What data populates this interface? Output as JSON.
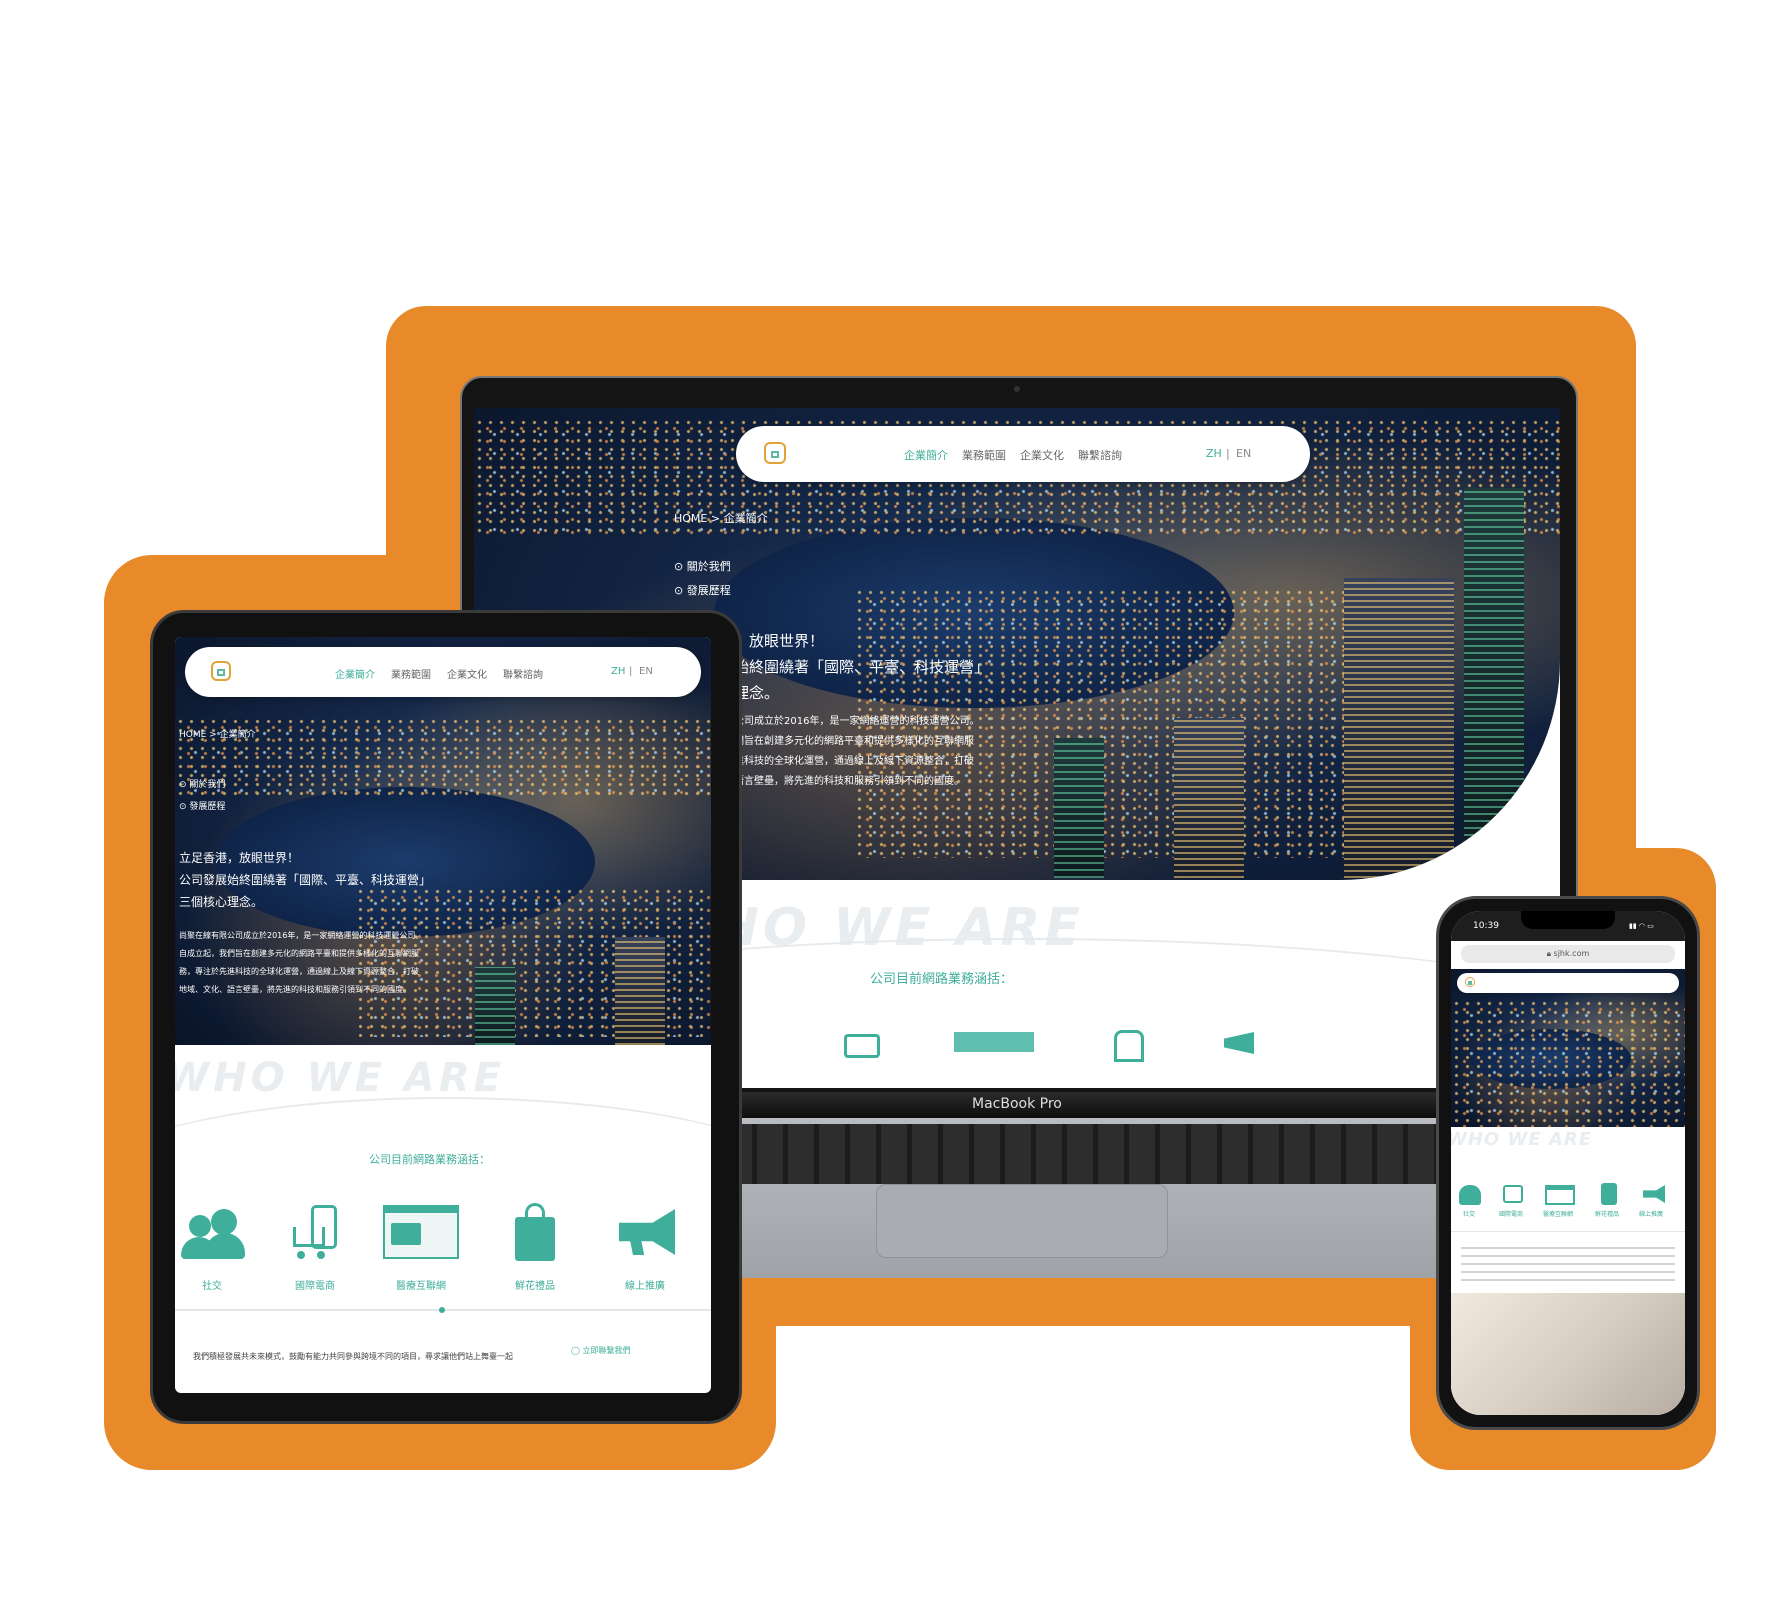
{
  "brand_colors": {
    "orange": "#e8892a",
    "teal": "#3fae9a",
    "dark": "#1a1a1a"
  },
  "laptop": {
    "model_label": "MacBook Pro",
    "nav": [
      "企業簡介",
      "業務範圍",
      "企業文化",
      "聯繫諮詢"
    ],
    "lang": {
      "zh": "ZH",
      "sep": "|",
      "en": "EN"
    },
    "breadcrumb": "HOME > 企業簡介",
    "side_links": [
      "關於我們",
      "發展歷程"
    ],
    "headline": [
      "立足香港，放眼世界！",
      "公司發展始終圍繞著「國際、平臺、科技運營」",
      "三個核心理念。"
    ],
    "body": [
      "尚聚在線有限公司成立於2016年，是一家網絡運營的科技運營公司。",
      "自成立起，我們旨在創建多元化的網路平臺和提供多樣化的互聯網服",
      "務，專注於先進科技的全球化運營，通過線上及線下資源整合，打破",
      "地域、文化、語言壁壘，將先進的科技和服務引領到不同的國度。"
    ],
    "ghost": "WHO WE ARE",
    "services_title": "公司目前網路業務涵括："
  },
  "tablet": {
    "nav": [
      "企業簡介",
      "業務範圍",
      "企業文化",
      "聯繫諮詢"
    ],
    "lang": {
      "zh": "ZH",
      "sep": "|",
      "en": "EN"
    },
    "breadcrumb": "HOME > 企業簡介",
    "side_links": [
      "關於我們",
      "發展歷程"
    ],
    "headline": [
      "立足香港，放眼世界！",
      "公司發展始終圍繞著「國際、平臺、科技運營」",
      "三個核心理念。"
    ],
    "body": [
      "尚聚在線有限公司成立於2016年，是一家網絡運營的科技運營公司。",
      "自成立起，我們旨在創建多元化的網路平臺和提供多樣化的互聯網服",
      "務，專注於先進科技的全球化運營，通過線上及線下資源整合，打破",
      "地域、文化、語言壁壘，將先進的科技和服務引領到不同的國度。"
    ],
    "ghost": "WHO WE ARE",
    "services_title": "公司目前網路業務涵括：",
    "services": [
      "社交",
      "國際電商",
      "醫療互聯網",
      "鮮花禮品",
      "線上推廣"
    ],
    "footer_text": "我們積極發展共未來模式，鼓勵有能力共同參與跨境不同的項目，尋求讓他們站上舞臺一起",
    "consult": "立即聯繫我們"
  },
  "phone": {
    "time": "10:39",
    "url": "sjhk.com",
    "services": [
      "社交",
      "國際電商",
      "醫療互聯網",
      "鮮花禮品",
      "線上推廣"
    ],
    "ghost": "WHO WE ARE"
  }
}
